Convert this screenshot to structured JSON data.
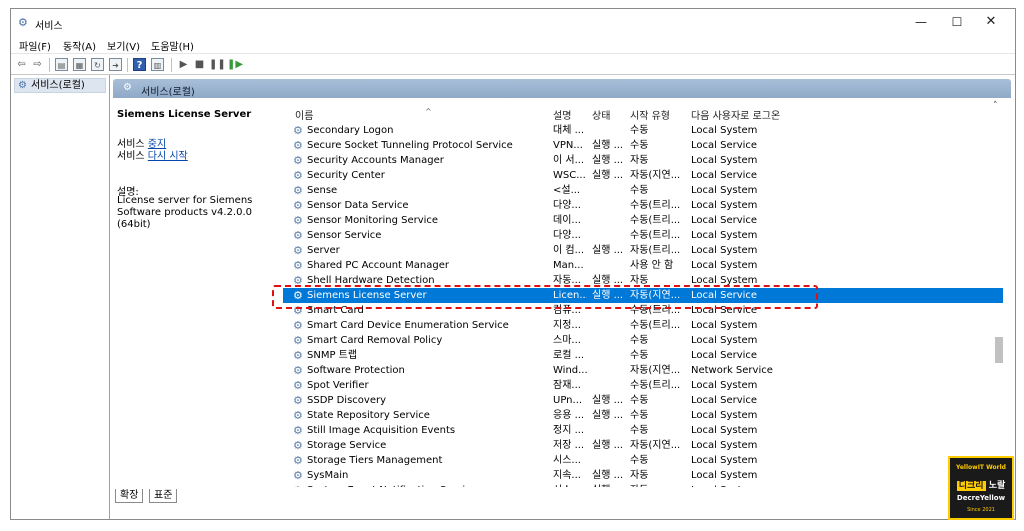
{
  "window": {
    "title": "서비스"
  },
  "menu": [
    "파일(F)",
    "동작(A)",
    "보기(V)",
    "도움말(H)"
  ],
  "left_pane": {
    "tree_item": "서비스(로컬)"
  },
  "pane_header": "서비스(로컬)",
  "ext_panel": {
    "title": "Siemens License Server",
    "stop_prefix": "서비스 ",
    "stop_link": "중지",
    "restart_prefix": "서비스 ",
    "restart_link": "다시 시작",
    "desc_label": "설명:",
    "desc": "License server for Siemens Software products v4.2.0.0 (64bit)"
  },
  "columns": {
    "name": "이름",
    "desc": "설명",
    "status": "상태",
    "start": "시작 유형",
    "logon": "다음 사용자로 로그온"
  },
  "rows": [
    {
      "name": "Secondary Logon",
      "desc": "대체 ...",
      "status": "",
      "start": "수동",
      "logon": "Local System"
    },
    {
      "name": "Secure Socket Tunneling Protocol Service",
      "desc": "VPN...",
      "status": "실행 ...",
      "start": "수동",
      "logon": "Local Service"
    },
    {
      "name": "Security Accounts Manager",
      "desc": "이 서...",
      "status": "실행 ...",
      "start": "자동",
      "logon": "Local System"
    },
    {
      "name": "Security Center",
      "desc": "WSC...",
      "status": "실행 ...",
      "start": "자동(지연...",
      "logon": "Local Service"
    },
    {
      "name": "Sense",
      "desc": "<설...",
      "status": "",
      "start": "수동",
      "logon": "Local System"
    },
    {
      "name": "Sensor Data Service",
      "desc": "다양...",
      "status": "",
      "start": "수동(트리...",
      "logon": "Local System"
    },
    {
      "name": "Sensor Monitoring Service",
      "desc": "데이...",
      "status": "",
      "start": "수동(트리...",
      "logon": "Local Service"
    },
    {
      "name": "Sensor Service",
      "desc": "다양...",
      "status": "",
      "start": "수동(트리...",
      "logon": "Local System"
    },
    {
      "name": "Server",
      "desc": "이 컴...",
      "status": "실행 ...",
      "start": "자동(트리...",
      "logon": "Local System"
    },
    {
      "name": "Shared PC Account Manager",
      "desc": "Man...",
      "status": "",
      "start": "사용 안 함",
      "logon": "Local System"
    },
    {
      "name": "Shell Hardware Detection",
      "desc": "자동...",
      "status": "실행 ...",
      "start": "자동",
      "logon": "Local System"
    },
    {
      "name": "Siemens License Server",
      "desc": "Licen...",
      "status": "실행 ...",
      "start": "자동(지연...",
      "logon": "Local Service"
    },
    {
      "name": "Smart Card",
      "desc": "컴퓨...",
      "status": "",
      "start": "수동(트리...",
      "logon": "Local Service"
    },
    {
      "name": "Smart Card Device Enumeration Service",
      "desc": "지정...",
      "status": "",
      "start": "수동(트리...",
      "logon": "Local System"
    },
    {
      "name": "Smart Card Removal Policy",
      "desc": "스마...",
      "status": "",
      "start": "수동",
      "logon": "Local System"
    },
    {
      "name": "SNMP 트랩",
      "desc": "로컬 ...",
      "status": "",
      "start": "수동",
      "logon": "Local Service"
    },
    {
      "name": "Software Protection",
      "desc": "Wind...",
      "status": "",
      "start": "자동(지연...",
      "logon": "Network Service"
    },
    {
      "name": "Spot Verifier",
      "desc": "잠재...",
      "status": "",
      "start": "수동(트리...",
      "logon": "Local System"
    },
    {
      "name": "SSDP Discovery",
      "desc": "UPn...",
      "status": "실행 ...",
      "start": "수동",
      "logon": "Local Service"
    },
    {
      "name": "State Repository Service",
      "desc": "응용 ...",
      "status": "실행 ...",
      "start": "수동",
      "logon": "Local System"
    },
    {
      "name": "Still Image Acquisition Events",
      "desc": "정지 ...",
      "status": "",
      "start": "수동",
      "logon": "Local System"
    },
    {
      "name": "Storage Service",
      "desc": "저장 ...",
      "status": "실행 ...",
      "start": "자동(지연...",
      "logon": "Local System"
    },
    {
      "name": "Storage Tiers Management",
      "desc": "시스...",
      "status": "",
      "start": "수동",
      "logon": "Local System"
    },
    {
      "name": "SysMain",
      "desc": "지속...",
      "status": "실행 ...",
      "start": "자동",
      "logon": "Local System"
    },
    {
      "name": "System Event Notification Service",
      "desc": "시스...",
      "status": "실행 ...",
      "start": "자동",
      "logon": "Local System"
    }
  ],
  "selected_row": 11,
  "tabs": [
    "확장",
    "표준"
  ],
  "logo": {
    "top": "YellowIT World",
    "mid_a": "디크리",
    "mid_b": "노랄",
    "bottom": "DecreYellow",
    "since": "Since 2021"
  },
  "colors": {
    "selection": "#0078d7",
    "highlight_box": "#e01010",
    "header": "#8fa9c7"
  }
}
